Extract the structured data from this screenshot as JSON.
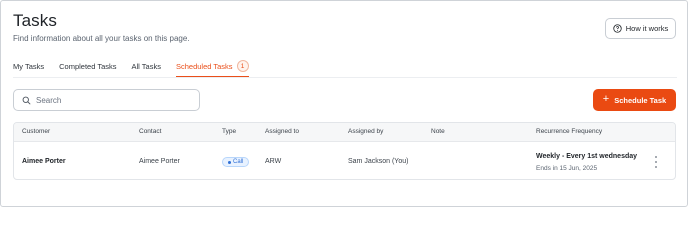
{
  "header": {
    "title": "Tasks",
    "subtitle": "Find information about all your tasks on this page.",
    "how_it_works_label": "How it works"
  },
  "tabs": [
    {
      "label": "My Tasks"
    },
    {
      "label": "Completed Tasks"
    },
    {
      "label": "All Tasks"
    },
    {
      "label": "Scheduled Tasks",
      "count": "1",
      "active": true
    }
  ],
  "search": {
    "placeholder": "Search",
    "value": ""
  },
  "schedule_button": {
    "label": "Schedule Task"
  },
  "table": {
    "columns": [
      "Customer",
      "Contact",
      "Type",
      "Assigned to",
      "Assigned by",
      "Note",
      "Recurrence Frequency"
    ],
    "rows": [
      {
        "customer": "Aimee Porter",
        "contact": "Aimee Porter",
        "type": "Call",
        "assigned_to": "ARW",
        "assigned_by": "Sam Jackson (You)",
        "note": "",
        "recurrence": "Weekly - Every 1st wednesday",
        "recurrence_end": "Ends in 15 Jun, 2025"
      }
    ]
  },
  "colors": {
    "accent": "#ea4a12",
    "type_pill": "#2f6fd6"
  },
  "icons": {
    "how_it_works": "help-circle-icon",
    "search": "search-icon",
    "add": "plus-icon",
    "row_menu": "more-vertical-icon"
  }
}
